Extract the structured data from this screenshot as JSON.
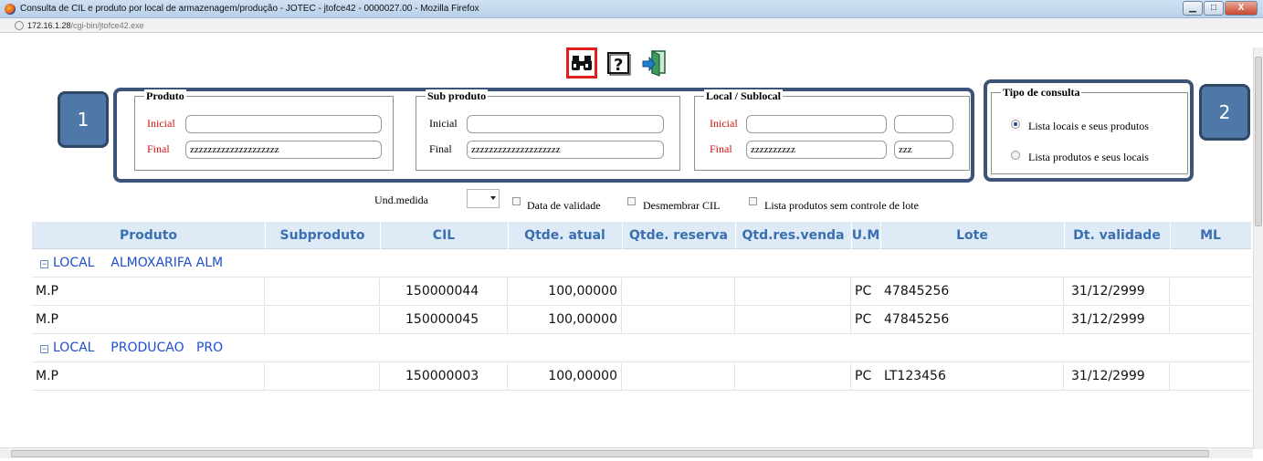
{
  "window": {
    "title": "Consulta de CIL e produto por local de armazenagem/produção - JOTEC - jtofce42 - 0000027.00 - Mozilla Firefox",
    "url_host": "172.16.1.28",
    "url_path": "/cgi-bin/jtofce42.exe",
    "btn_min": "▁",
    "btn_max": "□",
    "btn_close": "X"
  },
  "toolbar": {
    "icons": [
      "binoculars-icon",
      "help-icon",
      "exit-door-icon"
    ],
    "help_glyph": "?"
  },
  "annotations": {
    "badge1": "1",
    "badge2": "2"
  },
  "produto": {
    "legend": "Produto",
    "inicial_label": "Inicial",
    "inicial_value": "",
    "final_label": "Final",
    "final_value": "zzzzzzzzzzzzzzzzzzzz"
  },
  "sub_produto": {
    "legend": "Sub produto",
    "inicial_label": "Inicial",
    "inicial_value": "",
    "final_label": "Final",
    "final_value": "zzzzzzzzzzzzzzzzzzzz"
  },
  "local": {
    "legend": "Local / Sublocal",
    "inicial_label": "Inicial",
    "inicial_local": "",
    "inicial_sub": "",
    "final_label": "Final",
    "final_local": "zzzzzzzzzz",
    "final_sub": "zzz"
  },
  "tipo_consulta": {
    "legend": "Tipo de consulta",
    "options": [
      {
        "label": "Lista locais e seus produtos",
        "selected": true
      },
      {
        "label": "Lista produtos e seus locais",
        "selected": false
      }
    ]
  },
  "options": {
    "und_medida_label": "Und.medida",
    "und_medida_value": "",
    "data_validade": "Data de validade",
    "desmembrar": "Desmembrar CIL",
    "sem_lote": "Lista produtos sem controle de lote"
  },
  "grid": {
    "columns": [
      "Produto",
      "Subproduto",
      "CIL",
      "Qtde. atual",
      "Qtde. reserva",
      "Qtd.res.venda",
      "U.M",
      "Lote",
      "Dt. validade",
      "ML"
    ],
    "groups": [
      {
        "toggle": "−",
        "label": "LOCAL    ALMOXARIFA ALM",
        "rows": [
          [
            "M.P",
            "",
            "150000044",
            "100,00000",
            "",
            "",
            "PC",
            "47845256",
            "31/12/2999",
            ""
          ],
          [
            "M.P",
            "",
            "150000045",
            "100,00000",
            "",
            "",
            "PC",
            "47845256",
            "31/12/2999",
            ""
          ]
        ]
      },
      {
        "toggle": "−",
        "label": "LOCAL    PRODUCAO   PRO",
        "rows": [
          [
            "M.P",
            "",
            "150000003",
            "100,00000",
            "",
            "",
            "PC",
            "LT123456",
            "31/12/2999",
            ""
          ]
        ]
      }
    ]
  },
  "colors": {
    "accent": "#3b5477",
    "badge": "#4f77a8",
    "header_text": "#3a6fb0",
    "group_text": "#1f4fd0",
    "required_label": "#d01010"
  }
}
